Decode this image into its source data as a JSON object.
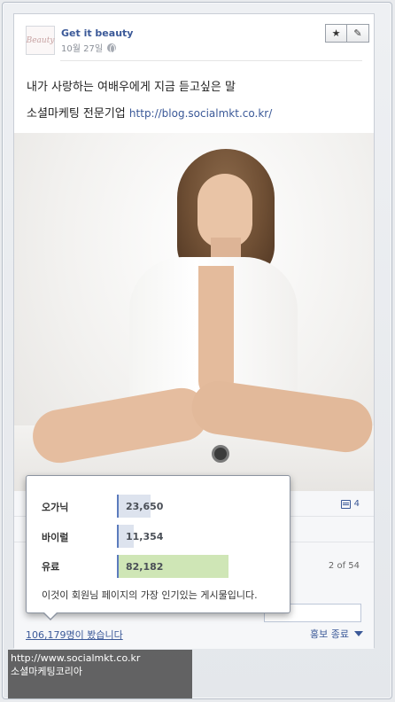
{
  "post": {
    "author": "Get it beauty",
    "date": "10월 27일",
    "avatar_text": "Beauty",
    "message_line1": "내가 사랑하는 여배우에게 지금 듣고싶은 말",
    "message_line2_prefix": "소셜마케팅 전문기업",
    "message_link": "http://blog.socialmkt.co.kr/",
    "comment_count": "4",
    "pager": "2 of 54",
    "views_link": "106,179명이 봤습니다",
    "promote_label": "홍보 종료"
  },
  "buttons": {
    "star_icon": "★",
    "pencil_icon": "✎"
  },
  "stats_popup": {
    "rows": [
      {
        "label": "오가닉",
        "value": "23,650",
        "number": 23650,
        "color": "#dde3ee"
      },
      {
        "label": "바이럴",
        "value": "11,354",
        "number": 11354,
        "color": "#dde3ee"
      },
      {
        "label": "유료",
        "value": "82,182",
        "number": 82182,
        "color": "#cfe6b6"
      }
    ],
    "note": "이것이 회원님 페이지의 가장 인기있는 게시물입니다."
  },
  "watermark": {
    "line1": "http://www.socialmkt.co.kr",
    "line2": "소셜마케팅코리아"
  }
}
